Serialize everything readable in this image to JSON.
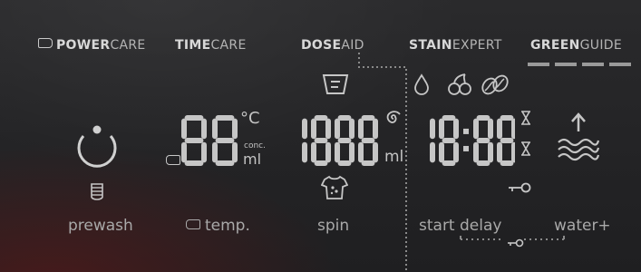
{
  "header": {
    "power": {
      "bold": "POWER",
      "light": "CARE"
    },
    "time": {
      "bold": "TIME",
      "light": "CARE"
    },
    "dose": {
      "bold": "DOSE",
      "light": "AID"
    },
    "stain": {
      "bold": "STAIN",
      "light": "EXPERT"
    },
    "green": {
      "bold": "GREEN",
      "light": "GUIDE"
    }
  },
  "display": {
    "temperature": "88",
    "temp_unit_c": "°C",
    "conc_label": "conc.",
    "ml_label": "ml",
    "spin": "1888",
    "spin_unit": "ml",
    "time": "18:88"
  },
  "buttons": {
    "prewash": "prewash",
    "temp": "temp.",
    "spin": "spin",
    "start_delay": "start delay",
    "water_plus": "water+"
  },
  "colors": {
    "background": "#222224",
    "segment": "#c6c6c6",
    "label": "#a9a9a9"
  },
  "icons": [
    "power-icon",
    "battery-icon",
    "detergent-drawer-icon",
    "spiral-icon",
    "shirt-stain-icon",
    "drop-icon",
    "cherry-icon",
    "coffee-bean-icon",
    "hourglass-icon",
    "key-lock-icon",
    "water-plus-icon"
  ]
}
